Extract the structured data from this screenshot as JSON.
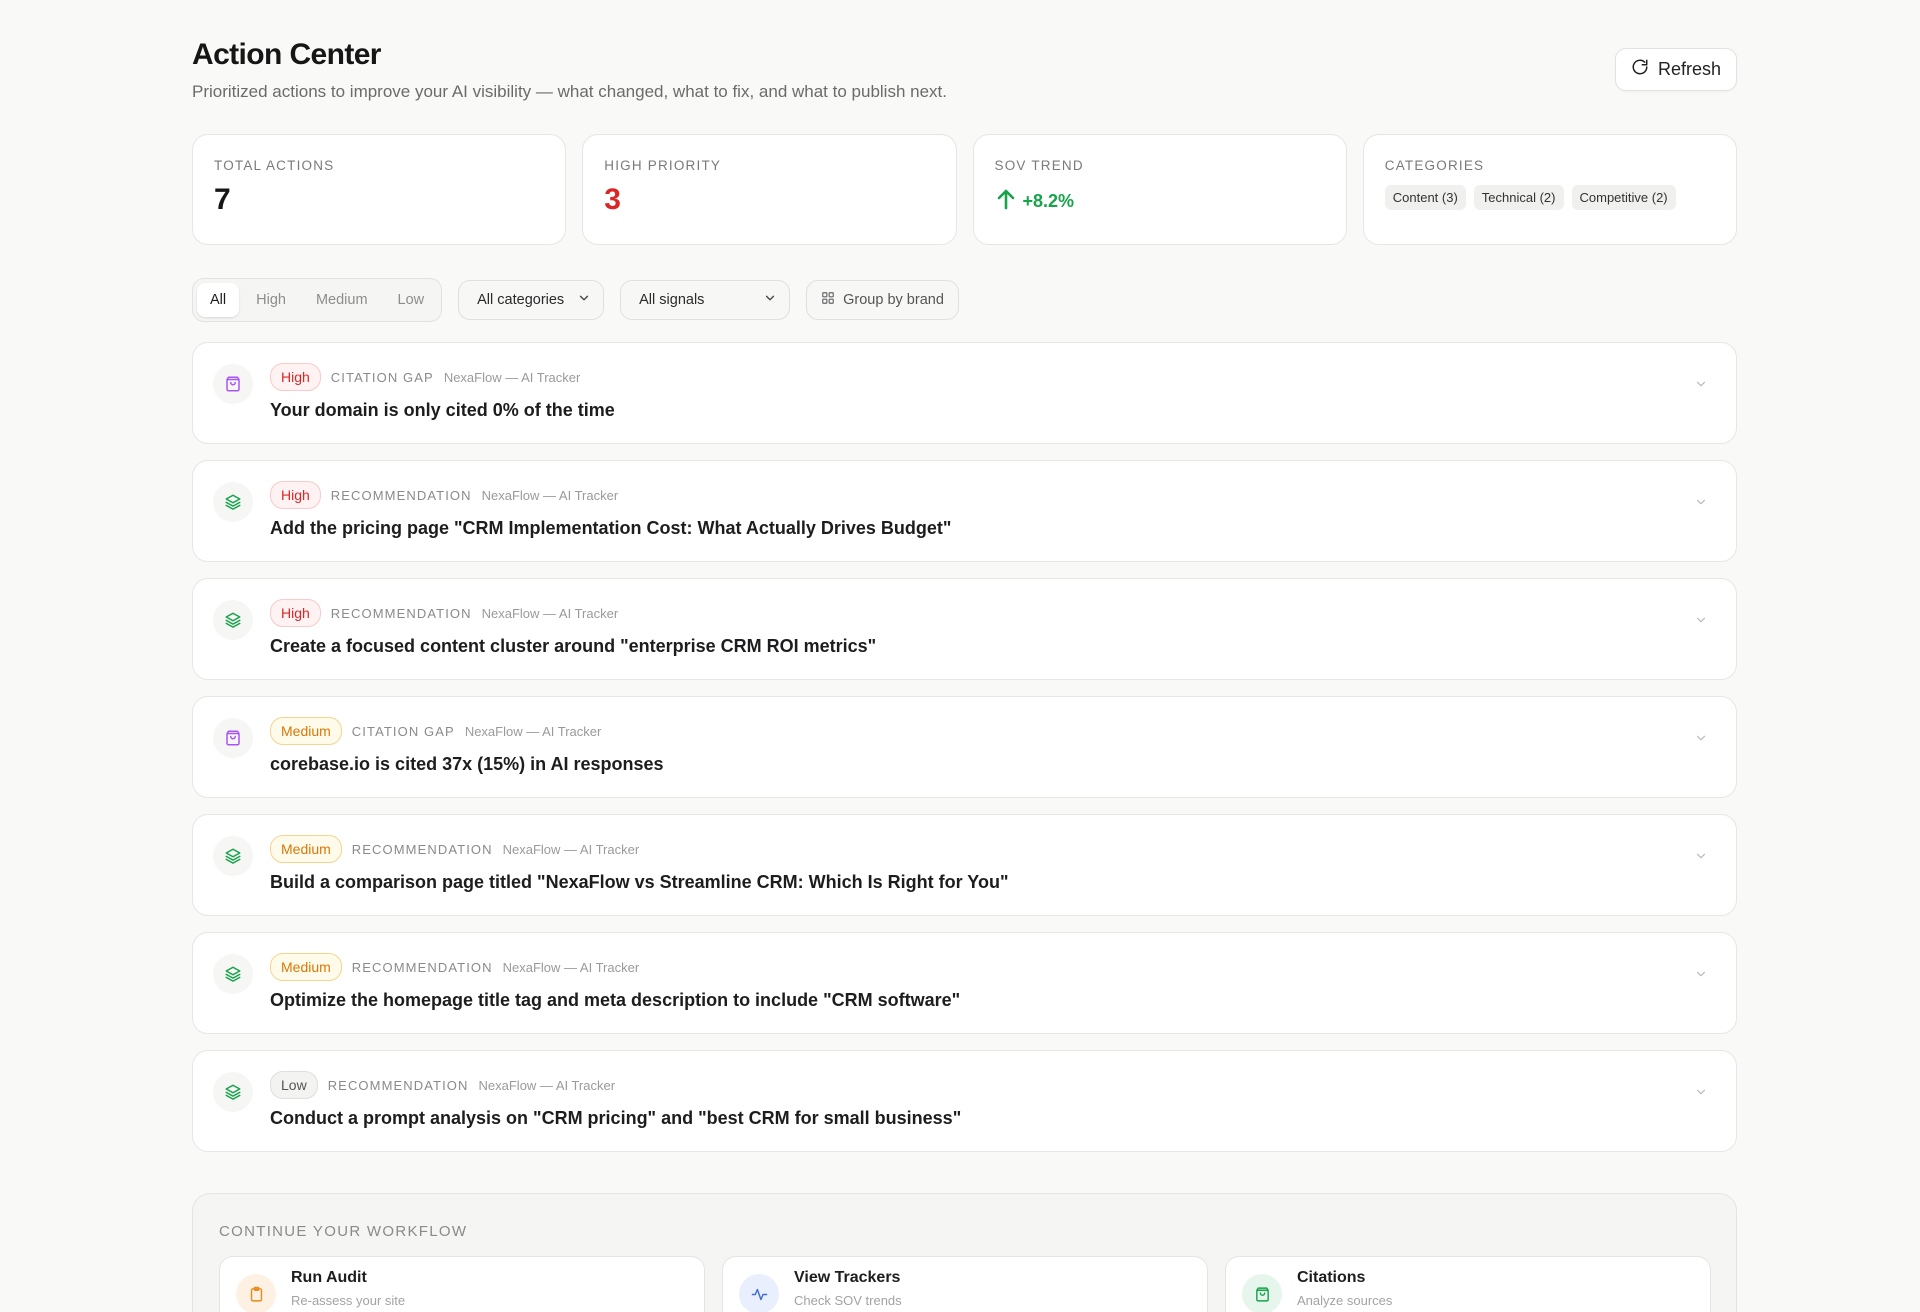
{
  "header": {
    "title": "Action Center",
    "subtitle": "Prioritized actions to improve your AI visibility — what changed, what to fix, and what to publish next.",
    "refresh_label": "Refresh"
  },
  "stats": {
    "total_actions": {
      "label": "TOTAL ACTIONS",
      "value": "7"
    },
    "high_priority": {
      "label": "HIGH PRIORITY",
      "value": "3"
    },
    "sov_trend": {
      "label": "SOV TREND",
      "value": "+8.2%"
    },
    "categories": {
      "label": "CATEGORIES",
      "chips": [
        "Content (3)",
        "Technical (2)",
        "Competitive (2)"
      ]
    }
  },
  "filters": {
    "priority_options": [
      "All",
      "High",
      "Medium",
      "Low"
    ],
    "priority_selected": "All",
    "category_select": "All categories",
    "signal_select": "All signals",
    "group_by_label": "Group by brand"
  },
  "actions": [
    {
      "priority": "High",
      "type": "CITATION GAP",
      "source": "NexaFlow — AI Tracker",
      "title": "Your domain is only cited 0% of the time",
      "icon": "shopping-bag-icon"
    },
    {
      "priority": "High",
      "type": "RECOMMENDATION",
      "source": "NexaFlow — AI Tracker",
      "title": "Add the pricing page \"CRM Implementation Cost: What Actually Drives Budget\"",
      "icon": "layers-icon"
    },
    {
      "priority": "High",
      "type": "RECOMMENDATION",
      "source": "NexaFlow — AI Tracker",
      "title": "Create a focused content cluster around \"enterprise CRM ROI metrics\"",
      "icon": "layers-icon"
    },
    {
      "priority": "Medium",
      "type": "CITATION GAP",
      "source": "NexaFlow — AI Tracker",
      "title": "corebase.io is cited 37x (15%) in AI responses",
      "icon": "shopping-bag-icon"
    },
    {
      "priority": "Medium",
      "type": "RECOMMENDATION",
      "source": "NexaFlow — AI Tracker",
      "title": "Build a comparison page titled \"NexaFlow vs Streamline CRM: Which Is Right for You\"",
      "icon": "layers-icon"
    },
    {
      "priority": "Medium",
      "type": "RECOMMENDATION",
      "source": "NexaFlow — AI Tracker",
      "title": "Optimize the homepage title tag and meta description to include \"CRM software\"",
      "icon": "layers-icon"
    },
    {
      "priority": "Low",
      "type": "RECOMMENDATION",
      "source": "NexaFlow — AI Tracker",
      "title": "Conduct a prompt analysis on \"CRM pricing\" and \"best CRM for small business\"",
      "icon": "layers-icon"
    }
  ],
  "workflow": {
    "label": "CONTINUE YOUR WORKFLOW",
    "cards": [
      {
        "title": "Run Audit",
        "subtitle": "Re-assess your site",
        "icon": "clipboard-icon",
        "color": "#ea8a1c",
        "bg": "#fdf1e4"
      },
      {
        "title": "View Trackers",
        "subtitle": "Check SOV trends",
        "icon": "activity-icon",
        "color": "#3b6fd6",
        "bg": "#e9effc"
      },
      {
        "title": "Citations",
        "subtitle": "Analyze sources",
        "icon": "shopping-bag-icon",
        "color": "#16a34a",
        "bg": "#e7f6ec"
      }
    ]
  },
  "colors": {
    "high": "#dc2626",
    "medium": "#d97706",
    "trend_up": "#16a34a",
    "citation_icon": "#a855f7",
    "recommendation_icon": "#16a34a"
  }
}
